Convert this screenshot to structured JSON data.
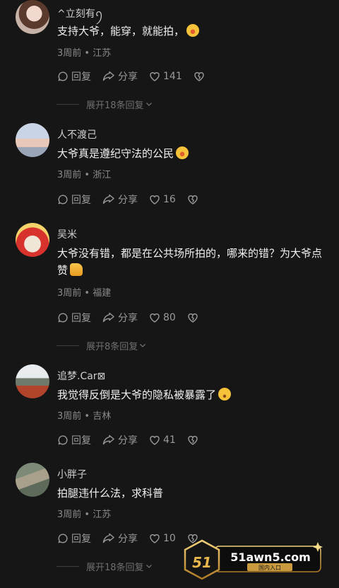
{
  "comments": [
    {
      "username": "^立刻有ꪆ",
      "text": "支持大爷，能穿，就能拍，",
      "time": "3周前",
      "location": "江苏",
      "reply_label": "回复",
      "share_label": "分享",
      "likes": "141",
      "emoji": "laughing-tears",
      "expand_text": "展开18条回复"
    },
    {
      "username": "人不渡己",
      "text": "大爷真是遵纪守法的公民",
      "time": "3周前",
      "location": "浙江",
      "reply_label": "回复",
      "share_label": "分享",
      "likes": "16",
      "emoji": "laughing-tears"
    },
    {
      "username": "吴米",
      "text": "大爷没有错，都是在公共场所拍的，哪来的错？为大爷点赞",
      "time": "3周前",
      "location": "福建",
      "reply_label": "回复",
      "share_label": "分享",
      "likes": "80",
      "emoji": "thumbs-up",
      "expand_text": "展开8条回复"
    },
    {
      "username": "追梦.Car⊠",
      "text": "我觉得反倒是大爷的隐私被暴露了",
      "time": "3周前",
      "location": "吉林",
      "reply_label": "回复",
      "share_label": "分享",
      "likes": "41",
      "emoji": "surprised"
    },
    {
      "username": "小胖子",
      "text": "拍腿违什么法，求科普",
      "time": "3周前",
      "location": "江苏",
      "reply_label": "回复",
      "share_label": "分享",
      "likes": "10",
      "expand_text": "展开18条回复"
    }
  ],
  "watermark": {
    "logo_text": "51",
    "site": "51awn5.com",
    "subtitle": "国内入口"
  },
  "colors": {
    "background": "#161616",
    "text": "#f0f0f0",
    "muted": "#8a8a8a",
    "gold": "#d9a84a"
  }
}
